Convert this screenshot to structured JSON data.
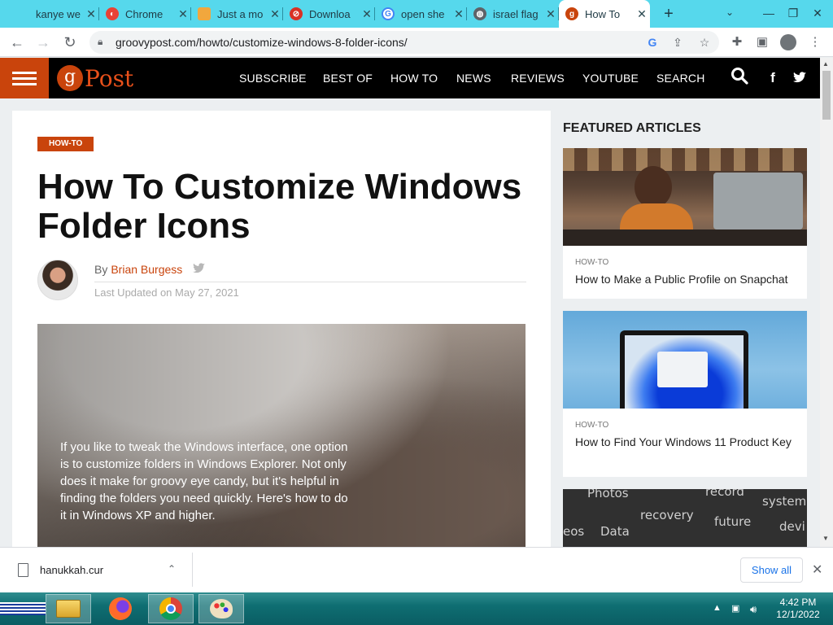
{
  "browser": {
    "tabs": [
      {
        "title": "kanye we",
        "favicon": "tab-page-icon",
        "favicon_color": "#7b5ea7"
      },
      {
        "title": "Chrome",
        "favicon": "chrome-webstore-icon",
        "favicon_color": "#e94235"
      },
      {
        "title": "Just a mo",
        "favicon": "cloudflare-icon",
        "favicon_color": "#f1a73d"
      },
      {
        "title": "Downloa",
        "favicon": "download-site-icon",
        "favicon_color": "#d93025"
      },
      {
        "title": "open she",
        "favicon": "google-icon",
        "favicon_color": "#4285f4"
      },
      {
        "title": "israel flag",
        "favicon": "globe-icon",
        "favicon_color": "#5f6368"
      },
      {
        "title": "How To",
        "favicon": "groovypost-icon",
        "favicon_color": "#c9440c",
        "active": true
      }
    ],
    "new_tab_label": "+",
    "url": "groovypost.com/howto/customize-windows-8-folder-icons/"
  },
  "site": {
    "logo_letter": "g",
    "logo_text": "Post",
    "nav": [
      "SUBSCRIBE",
      "BEST OF",
      "HOW TO",
      "NEWS",
      "REVIEWS",
      "YOUTUBE",
      "SEARCH"
    ],
    "brand_color": "#c9440c"
  },
  "article": {
    "category": "HOW-TO",
    "title": "How To Customize Windows Folder Icons",
    "by": "By",
    "author": "Brian Burgess",
    "updated": "Last Updated on May 27, 2021",
    "intro": "If you like to tweak the Windows interface, one option is to customize folders in Windows Explorer. Not only does it make for groovy eye candy, but it's helpful in finding the folders you need quickly. Here's how to do it in Windows XP and higher."
  },
  "sidebar": {
    "heading": "FEATURED ARTICLES",
    "cards": [
      {
        "tag": "HOW-TO",
        "title": "How to Make a Public Profile on Snapchat"
      },
      {
        "tag": "HOW-TO",
        "title": "How to Find Your Windows 11 Product Key"
      },
      {
        "words": [
          "Photos",
          "record",
          "system",
          "recovery",
          "future",
          "eos",
          "Data",
          "devi"
        ]
      }
    ]
  },
  "downloads": {
    "file": "hanukkah.cur",
    "show_all": "Show all"
  },
  "taskbar": {
    "time": "4:42 PM",
    "date": "12/1/2022"
  }
}
